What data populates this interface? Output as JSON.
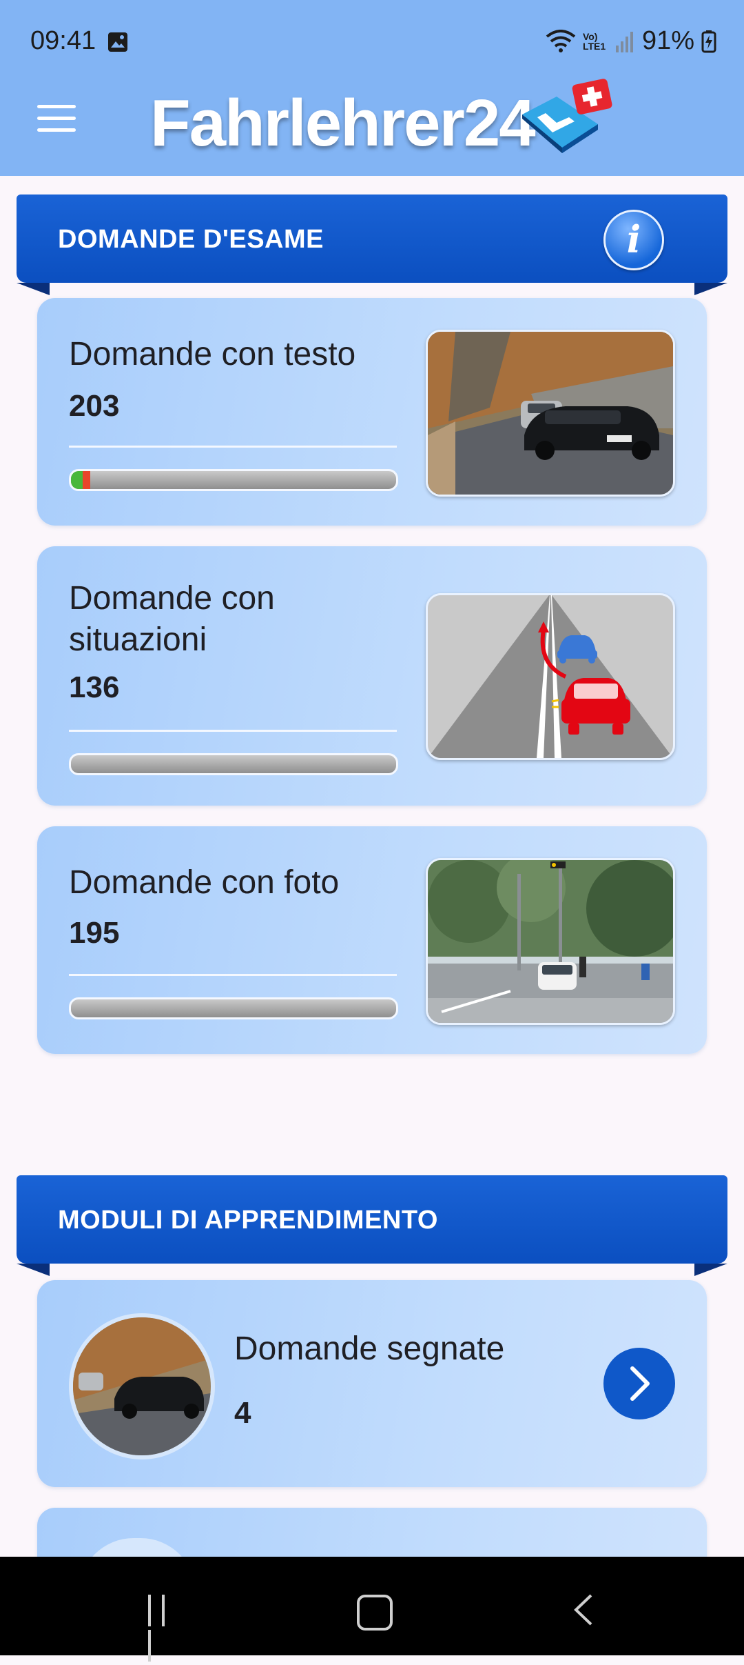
{
  "status_bar": {
    "time": "09:41",
    "battery": "91%",
    "network_label": "Vo) LTE1",
    "icons": [
      "gallery-icon",
      "wifi-icon",
      "volte-lte-icon",
      "signal-icon",
      "battery-charging-icon"
    ]
  },
  "app_bar": {
    "title": "Fahrlehrer24",
    "menu_icon": "hamburger-menu-icon",
    "logo_icon": "swiss-l-plate-logo"
  },
  "exam_section": {
    "title": "DOMANDE D'ESAME",
    "info_icon": "info-icon",
    "info_glyph": "i",
    "cards": [
      {
        "title": "Domande con testo",
        "count": "203",
        "progress_green": 0.035,
        "progress_red": 0.025,
        "thumbnail": "road-cars-photo"
      },
      {
        "title": "Domande con situazioni",
        "count": "136",
        "progress_green": 0,
        "progress_red": 0,
        "thumbnail": "road-situation-illustration"
      },
      {
        "title": "Domande con foto",
        "count": "195",
        "progress_green": 0,
        "progress_red": 0,
        "thumbnail": "street-intersection-photo"
      }
    ]
  },
  "modules_section": {
    "title": "MODULI DI APPRENDIMENTO",
    "items": [
      {
        "title": "Domande segnate",
        "count": "4",
        "avatar": "road-cars-photo",
        "arrow_icon": "chevron-right-icon"
      }
    ]
  },
  "colors": {
    "app_bar": "#82b4f4",
    "section_header": "#0b4fc0",
    "card_bg": "#b8d6fc",
    "arrow_button": "#0f58c9",
    "progress_green": "#48b73b",
    "progress_red": "#e9452b"
  },
  "nav_bar": {
    "icons": [
      "recents-icon",
      "home-icon",
      "back-icon"
    ]
  }
}
